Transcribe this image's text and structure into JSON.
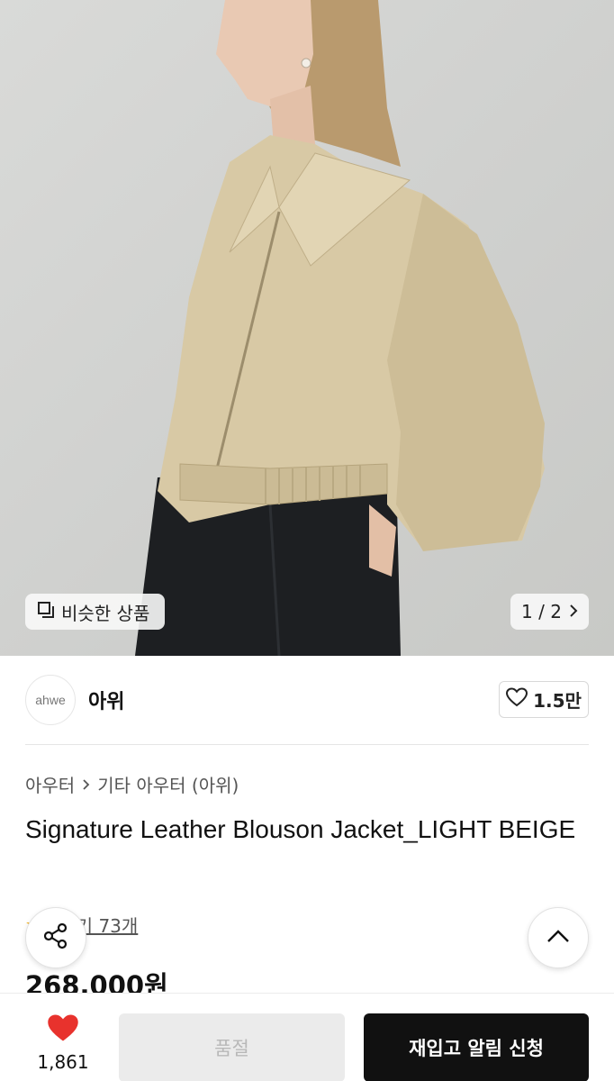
{
  "hero": {
    "similar_label": "비슷한 상품",
    "counter": "1 / 2"
  },
  "brand": {
    "logo_text": "ahwe",
    "name": "아위",
    "like_count": "1.5만"
  },
  "breadcrumb": {
    "category": "아우터",
    "subcategory": "기타 아우터 (아위)"
  },
  "product": {
    "title": "Signature Leather Blouson Jacket_LIGHT BEIGE",
    "review_text": "후기 73개",
    "price": "268,000원"
  },
  "bottom_bar": {
    "wish_count": "1,861",
    "soldout_label": "품절",
    "restock_label": "재입고 알림 신청"
  },
  "colors": {
    "accent_red": "#e8322d",
    "button_black": "#111111",
    "jacket_beige": "#d8c9a5"
  },
  "icons": [
    "copy-icon",
    "chevron-right-icon",
    "heart-outline-icon",
    "share-icon",
    "chevron-up-icon",
    "heart-filled-icon",
    "star-icon"
  ]
}
